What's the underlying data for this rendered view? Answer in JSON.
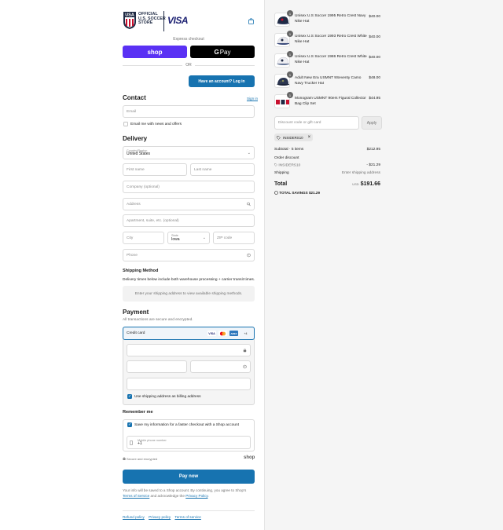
{
  "brand": {
    "crest_text": "USA",
    "store_line1": "OFFICIAL",
    "store_line2": "U.S. SOCCER",
    "store_line3": "STORE",
    "sponsor": "VISA",
    "colors": {
      "navy": "#1f2a44",
      "red": "#c8102e",
      "primary": "#1773b0",
      "shop_pay": "#5a31f4"
    }
  },
  "header": {
    "cart_icon": "shopping-bag-icon"
  },
  "express": {
    "label": "Express checkout",
    "shop_label": "shop",
    "gpay_g": "G",
    "gpay_label": "Pay",
    "or_label": "OR",
    "login_label": "Have an account? Log in"
  },
  "contact": {
    "heading": "Contact",
    "sign_in": "Sign in",
    "email_placeholder": "Email",
    "news_label": "Email me with news and offers"
  },
  "delivery": {
    "heading": "Delivery",
    "country_label": "Country/Region",
    "country_value": "United States",
    "first_name": "First name",
    "last_name": "Last name",
    "company": "Company (optional)",
    "address": "Address",
    "apartment": "Apartment, suite, etc. (optional)",
    "city": "City",
    "state_label": "State",
    "state_value": "Iowa",
    "zip": "ZIP code",
    "phone": "Phone"
  },
  "shipping": {
    "heading": "Shipping Method",
    "note": "Delivery times below include both warehouse processing + carrier transit times.",
    "placeholder": "Enter your shipping address to view available shipping methods."
  },
  "payment": {
    "heading": "Payment",
    "subtitle": "All transactions are secure and encrypted.",
    "method": "Credit card",
    "cards": [
      "VISA",
      "",
      "AMEX",
      "+4"
    ],
    "billing_label": "Use shipping address as billing address"
  },
  "remember": {
    "heading": "Remember me",
    "save_label": "Save my information for a faster checkout with a Shop account",
    "phone_label": "Mobile phone number",
    "phone_value": "+1",
    "secure": "Secure and encrypted",
    "shop": "shop"
  },
  "pay": {
    "button": "Pay now",
    "terms_pre": "Your info will be saved to a Shop account. By continuing, you agree to Shop's",
    "terms_link": "Terms of Service",
    "terms_mid": "and acknowledge the",
    "privacy_link": "Privacy Policy",
    "terms_end": "."
  },
  "footer": {
    "links": [
      "Refund policy",
      "Privacy policy",
      "Terms of service"
    ]
  },
  "cart": {
    "items": [
      {
        "qty": "1",
        "name": "Unisex U.S Soccer 1995 Retro Crest Navy Nike Hat",
        "price": "$40.00"
      },
      {
        "qty": "1",
        "name": "Unisex U.S Soccer 1993 Retro Crest White Nike Hat",
        "price": "$40.00"
      },
      {
        "qty": "1",
        "name": "Unisex U.S Soccer 1986 Retro Crest White Nike Hat",
        "price": "$40.00"
      },
      {
        "qty": "1",
        "name": "Adult New Era USMNT 9Seventy Camo Navy Trucker Hat",
        "price": "$48.00"
      },
      {
        "qty": "1",
        "name": "Monogram USMNT 90ers Figural Collector Bag Clip Set",
        "price": "$44.95"
      }
    ],
    "discount_placeholder": "Discount code or gift card",
    "apply": "Apply",
    "code": "INSIDERS10",
    "subtotal_label": "Subtotal · 5 items",
    "subtotal_value": "$212.95",
    "order_discount_label": "Order discount",
    "discount_code": "INSIDERS10",
    "discount_value": "- $21.29",
    "shipping_label": "Shipping",
    "shipping_value": "Enter shipping address",
    "total_label": "Total",
    "currency": "USD",
    "total_value": "$191.66",
    "savings_label": "TOTAL SAVINGS",
    "savings_value": "$21.29"
  }
}
